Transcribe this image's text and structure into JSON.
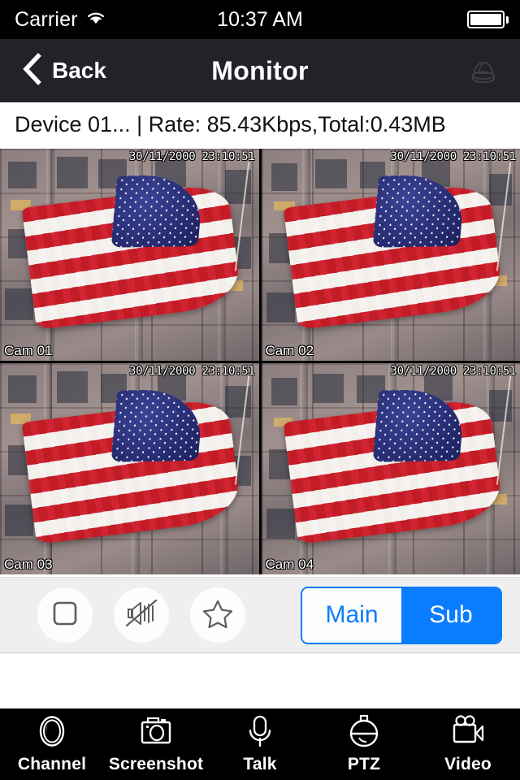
{
  "status_bar": {
    "carrier": "Carrier",
    "wifi_icon": "wifi-icon",
    "time": "10:37 AM",
    "battery_icon": "battery-full-icon"
  },
  "nav_bar": {
    "back_icon": "chevron-left-icon",
    "back_label": "Back",
    "title": "Monitor",
    "right_icon": "dome-camera-icon"
  },
  "info_bar": {
    "text": "Device 01... | Rate: 85.43Kbps,Total:0.43MB"
  },
  "video_grid": {
    "selection_color": "#25e0ef",
    "cells": [
      {
        "label": "Cam 01",
        "timestamp": "30/11/2000 23:10:51",
        "selected": true
      },
      {
        "label": "Cam 02",
        "timestamp": "30/11/2000 23:10:51",
        "selected": false
      },
      {
        "label": "Cam 03",
        "timestamp": "30/11/2000 23:10:51",
        "selected": false
      },
      {
        "label": "Cam 04",
        "timestamp": "30/11/2000 23:10:51",
        "selected": false
      }
    ]
  },
  "control_bar": {
    "stop_icon": "stop-square-icon",
    "mute_icon": "speaker-mute-icon",
    "favorite_icon": "star-icon",
    "stream": {
      "main_label": "Main",
      "sub_label": "Sub",
      "selected": "Sub",
      "accent_color": "#0a7cff"
    }
  },
  "tab_bar": {
    "tabs": [
      {
        "label": "Channel",
        "icon": "channel-lens-icon"
      },
      {
        "label": "Screenshot",
        "icon": "camera-icon"
      },
      {
        "label": "Talk",
        "icon": "microphone-icon"
      },
      {
        "label": "PTZ",
        "icon": "dome-camera-icon"
      },
      {
        "label": "Video",
        "icon": "video-camera-icon"
      }
    ]
  }
}
